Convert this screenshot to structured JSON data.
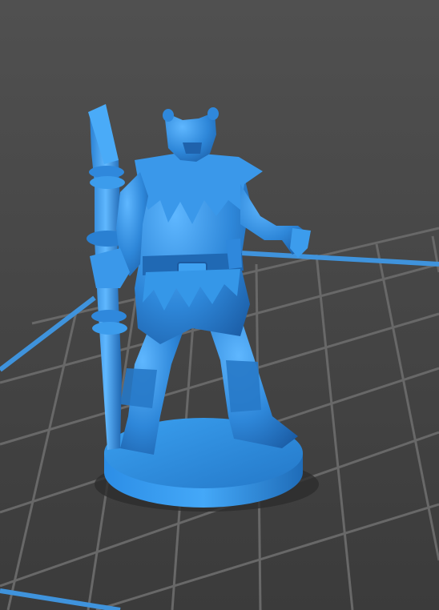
{
  "scene": {
    "subject": "miniature-figure",
    "colors": {
      "background_top": "#4f4f4f",
      "background_bottom": "#3c3c3c",
      "grid_line": "#6a6a6a",
      "bed_edge": "#3c8fd6",
      "model_base": "#2f8fe0",
      "model_light": "#5db4ff",
      "model_mid": "#2e86d8",
      "model_dark": "#1d5ea8",
      "shadow": "#2c2c2c"
    }
  }
}
